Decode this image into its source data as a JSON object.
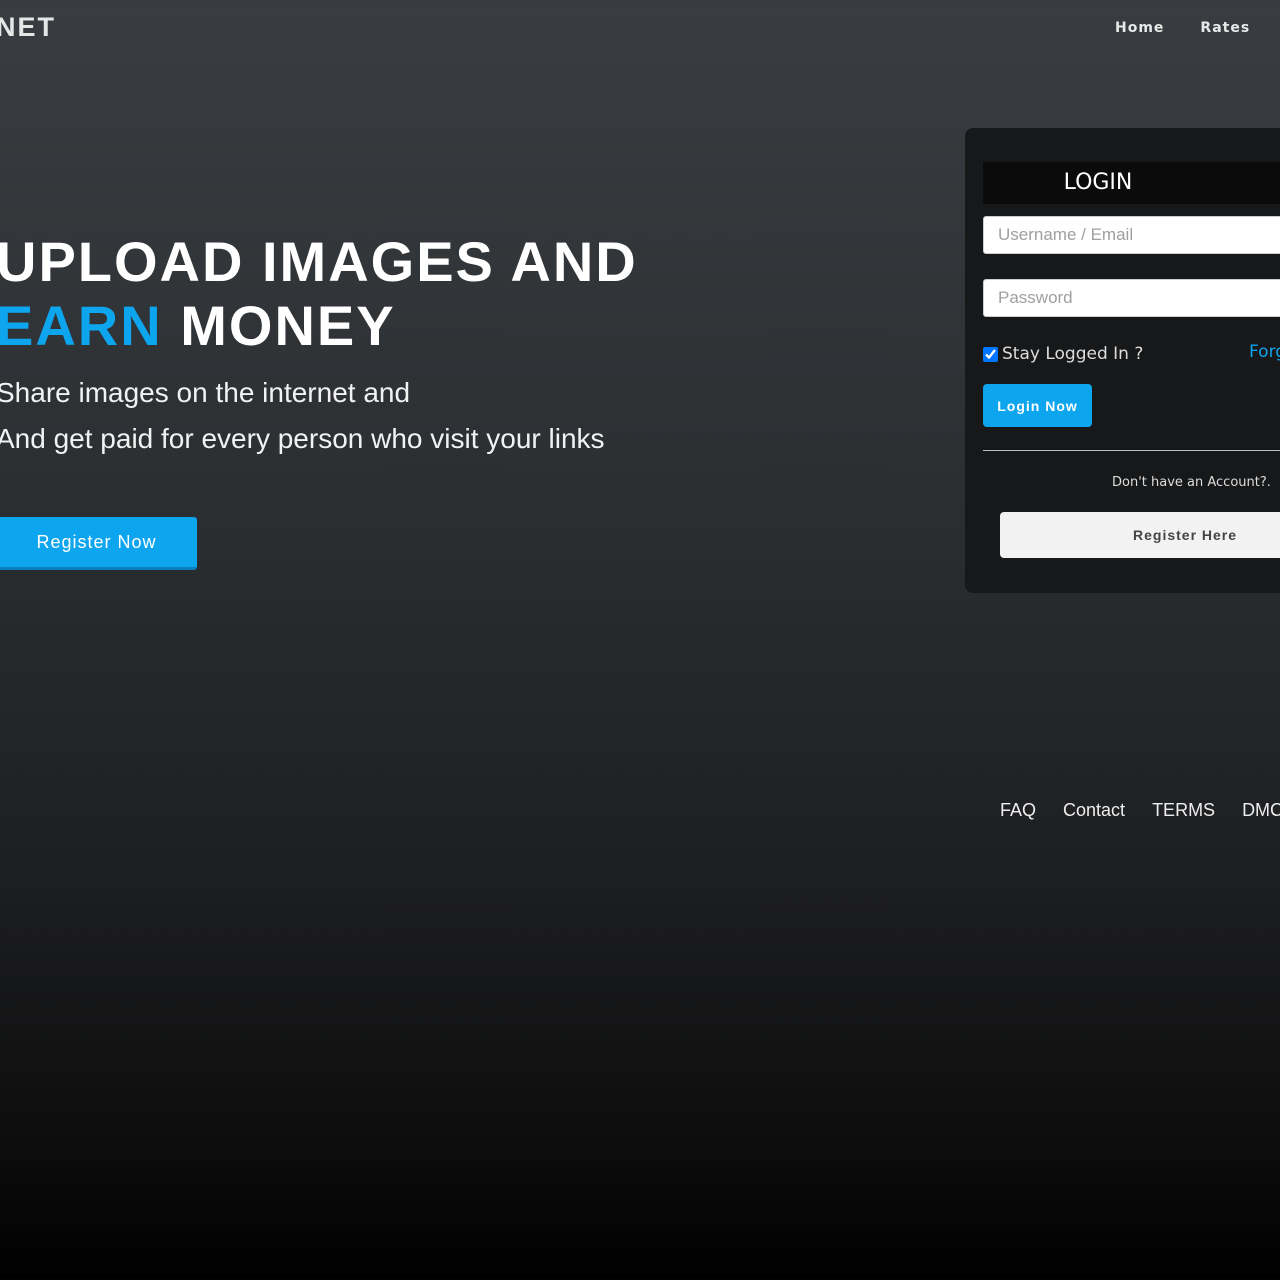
{
  "header": {
    "logo": "NET",
    "nav": [
      "Home",
      "Rates"
    ]
  },
  "hero": {
    "line1": "UPLOAD IMAGES AND",
    "line2_accent": "EARN",
    "line2_rest": " MONEY",
    "sub1": "Share images on the internet and",
    "sub2": "And get paid for every person who visit your links",
    "register_button": "Register Now"
  },
  "login": {
    "title": "LOGIN",
    "username_placeholder": "Username / Email",
    "password_placeholder": "Password",
    "stay_logged_in": "Stay Logged In ?",
    "stay_checked": true,
    "forgot": "Forg",
    "login_button": "Login Now",
    "no_account": "Don't have an Account?.",
    "register_here": "Register Here"
  },
  "footer": {
    "links": [
      "FAQ",
      "Contact",
      "TERMS",
      "DMC"
    ]
  },
  "colors": {
    "accent": "#0ea5ef"
  }
}
